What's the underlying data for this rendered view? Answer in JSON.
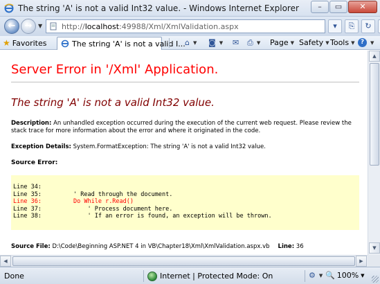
{
  "window": {
    "title": "The string 'A' is not a valid Int32 value. - Windows Internet Explorer",
    "min_glyph": "–",
    "max_glyph": "▭",
    "close_glyph": "✕"
  },
  "address": {
    "url_prefix": "http://",
    "url_host": "localhost",
    "url_rest": ":49988/Xml/XmlValidation.aspx",
    "back_glyph": "←",
    "forward_glyph": "→",
    "tools": [
      {
        "icon": "dropdown-icon",
        "glyph": "▾"
      },
      {
        "icon": "compatibility-view-icon",
        "glyph": "⎘"
      },
      {
        "icon": "refresh-icon",
        "glyph": "↻"
      },
      {
        "icon": "stop-icon",
        "glyph": "✕"
      }
    ]
  },
  "toolbar": {
    "favorites_label": "Favorites",
    "tab_label": "The string 'A' is not a valid I...",
    "home_glyph": "⌂",
    "feeds_glyph": "◙",
    "mail_glyph": "✉",
    "print_glyph": "⎙",
    "page_label": "Page",
    "safety_label": "Safety",
    "tools_label": "Tools",
    "help_glyph": "?"
  },
  "page": {
    "server_error": "Server Error in '/Xml' Application.",
    "error_message": "The string 'A' is not a valid Int32 value.",
    "description_label": "Description:",
    "description_text": "An unhandled exception occurred during the execution of the current web request. Please review the stack trace for more information about the error and where it originated in the code.",
    "exception_label": "Exception Details:",
    "exception_text": "System.FormatException: The string 'A' is not a valid Int32 value.",
    "source_error_label": "Source Error:",
    "code_lines": [
      {
        "num": "Line 34:",
        "text": "",
        "highlight": false
      },
      {
        "num": "Line 35:",
        "text": "        ' Read through the document.",
        "highlight": false
      },
      {
        "num": "Line 36:",
        "text": "        Do While r.Read()",
        "highlight": true
      },
      {
        "num": "Line 37:",
        "text": "            ' Process document here.",
        "highlight": false
      },
      {
        "num": "Line 38:",
        "text": "            ' If an error is found, an exception will be thrown.",
        "highlight": false
      }
    ],
    "source_file_label": "Source File:",
    "source_file_path": "D:\\Code\\Beginning ASP.NET 4 in VB\\Chapter18\\Xml\\XmlValidation.aspx.vb",
    "line_label": "Line:",
    "line_value": "36"
  },
  "status": {
    "text": "Done",
    "zone": "Internet | Protected Mode: On",
    "zoom": "100%"
  },
  "colors": {
    "server_error": "#ff0000",
    "error_message": "#800000",
    "code_background": "#ffffcc",
    "code_highlight": "#ff0000"
  }
}
